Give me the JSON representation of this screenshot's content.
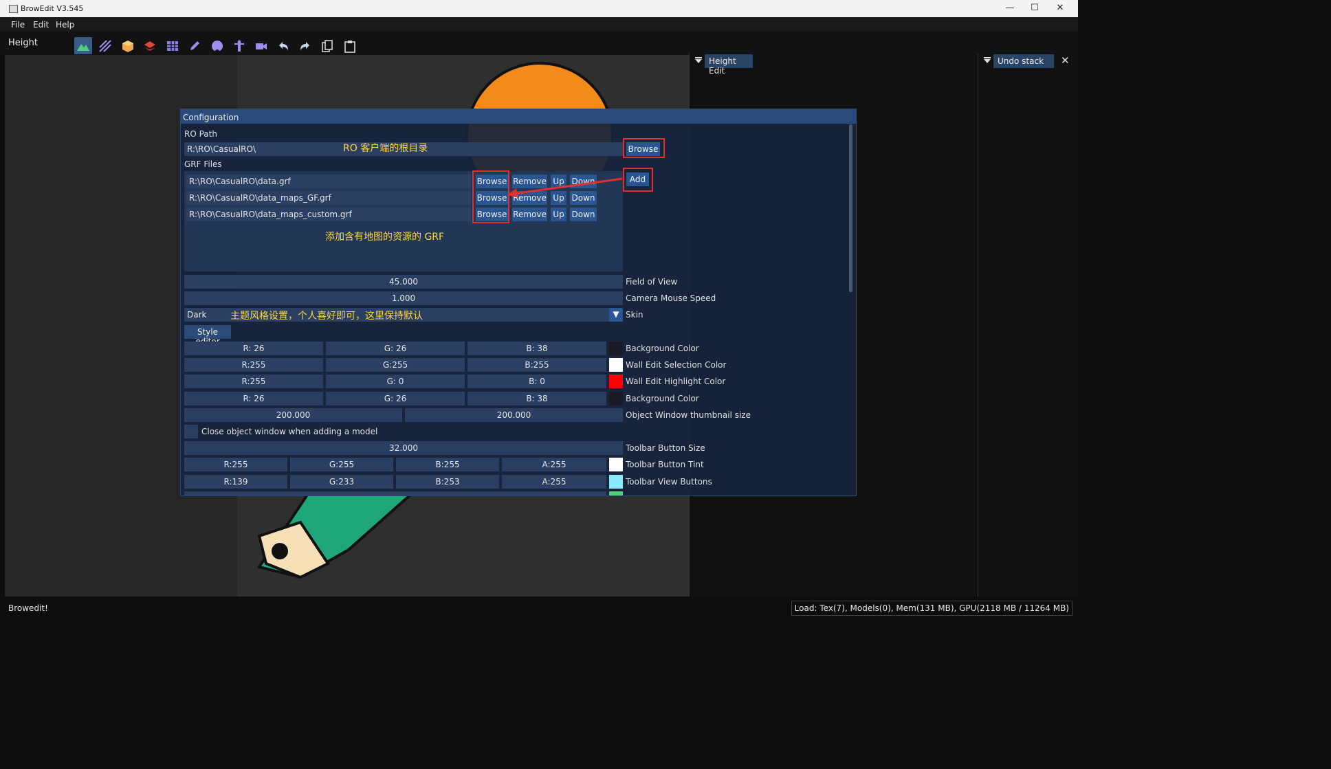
{
  "window": {
    "title": "BrowEdit V3.545"
  },
  "menu": {
    "file": "File",
    "edit": "Edit",
    "help": "Help"
  },
  "toolbar": {
    "mode_label": "Height",
    "buttons": [
      "height-mode-icon",
      "texture-mode-icon",
      "object-mode-icon",
      "wall-mode-icon",
      "gat-mode-icon",
      "pencil-icon",
      "circle-icon",
      "person-icon",
      "camera-icon",
      "undo-icon",
      "redo-icon",
      "copy-icon",
      "paste-icon"
    ]
  },
  "panels": {
    "height_edit": "Height Edit",
    "undo_stack": "Undo stack"
  },
  "config": {
    "title": "Configuration",
    "ro_path_label": "RO Path",
    "ro_path_value": "R:\\RO\\CasualRO\\",
    "ro_path_browse": "Browse",
    "ro_path_note": "RO 客户端的根目录",
    "grf_label": "GRF Files",
    "grf_add": "Add",
    "grf_files": [
      {
        "path": "R:\\RO\\CasualRO\\data.grf"
      },
      {
        "path": "R:\\RO\\CasualRO\\data_maps_GF.grf"
      },
      {
        "path": "R:\\RO\\CasualRO\\data_maps_custom.grf"
      }
    ],
    "grf_buttons": {
      "browse": "Browse",
      "remove": "Remove",
      "up": "Up",
      "down": "Down"
    },
    "grf_note": "添加含有地图的资源的 GRF",
    "fov_value": "45.000",
    "fov_label": "Field of View",
    "cam_speed_value": "1.000",
    "cam_speed_label": "Camera Mouse Speed",
    "skin_value": "Dark",
    "skin_note": "主题风格设置，个人喜好即可，这里保持默认",
    "skin_label": "Skin",
    "style_editor": "Style editor",
    "colors": [
      {
        "r": "R: 26",
        "g": "G: 26",
        "b": "B: 38",
        "swatch": "#1a1a26",
        "label": "Background Color"
      },
      {
        "r": "R:255",
        "g": "G:255",
        "b": "B:255",
        "swatch": "#ffffff",
        "label": "Wall Edit Selection Color"
      },
      {
        "r": "R:255",
        "g": "G:  0",
        "b": "B:  0",
        "swatch": "#ff0000",
        "label": "Wall Edit Highlight Color"
      },
      {
        "r": "R: 26",
        "g": "G: 26",
        "b": "B: 38",
        "swatch": "#1a1a26",
        "label": "Background Color"
      }
    ],
    "thumb_w": "200.000",
    "thumb_h": "200.000",
    "thumb_label": "Object Window thumbnail size",
    "close_obj_label": "Close object window when adding a model",
    "tb_size_value": "32.000",
    "tb_size_label": "Toolbar Button Size",
    "rgba_rows": [
      {
        "r": "R:255",
        "g": "G:255",
        "b": "B:255",
        "a": "A:255",
        "swatch": "#ffffff",
        "label": "Toolbar Button Tint"
      },
      {
        "r": "R:139",
        "g": "G:233",
        "b": "B:253",
        "a": "A:255",
        "swatch": "#8be9fd",
        "label": "Toolbar View Buttons"
      }
    ]
  },
  "status": {
    "left": "Browedit!",
    "right": "Load: Tex(7), Models(0), Mem(131 MB), GPU(2118 MB / 11264 MB)"
  },
  "colors": {
    "accent": "#2b5590",
    "dialog_title": "#294a7a",
    "annotation": "#ffd83d",
    "highlight_red": "#e2312c"
  }
}
